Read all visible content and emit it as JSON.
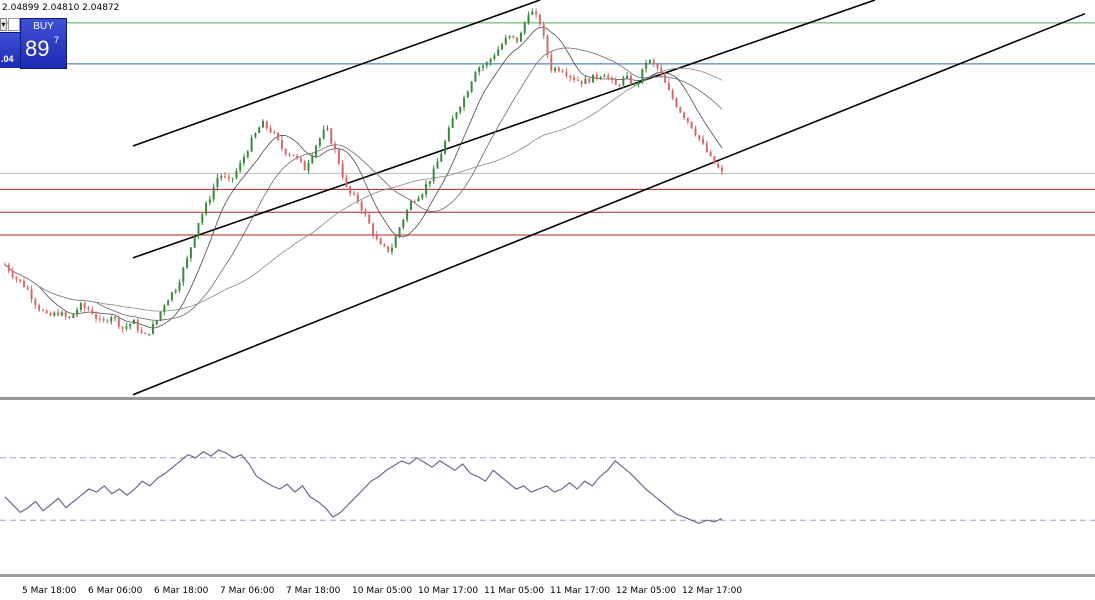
{
  "header": {
    "ohlc_text": "2.04899 2.04810 2.04872"
  },
  "trade_panel": {
    "dropdown_glyph": "▾",
    "buy_label": "BUY",
    "price_small": ".04",
    "price_big": "89",
    "price_sup": "7"
  },
  "colors": {
    "bull": "#3a8a3a",
    "bear": "#d46a6a",
    "ma_fast": "#4a4a4a",
    "ma_mid": "#6a6a6a",
    "ma_slow": "#8a8a8a",
    "channel": "#000000",
    "resistance_green": "#4caf50",
    "resistance_blue": "#2a6fb0",
    "support_red": "#b22222",
    "rsi_line": "#6a6a8e",
    "rsi_levels": "#9a9ab8"
  },
  "chart_data": {
    "type": "candlestick",
    "xlabel": "",
    "ylabel": "",
    "x_tick_labels": [
      "5 Mar 18:00",
      "6 Mar 06:00",
      "6 Mar 18:00",
      "7 Mar 06:00",
      "7 Mar 18:00",
      "10 Mar 05:00",
      "10 Mar 17:00",
      "11 Mar 05:00",
      "11 Mar 17:00",
      "12 Mar 05:00",
      "12 Mar 17:00"
    ],
    "price_path_closes": [
      2.009,
      2.006,
      2.004,
      2.0,
      1.9975,
      1.9985,
      1.997,
      2.0,
      1.999,
      1.996,
      1.998,
      1.995,
      1.9965,
      1.993,
      1.996,
      2.001,
      2.004,
      2.01,
      2.018,
      2.023,
      2.029,
      2.027,
      2.031,
      2.036,
      2.04,
      2.038,
      2.034,
      2.033,
      2.03,
      2.035,
      2.039,
      2.033,
      2.025,
      2.023,
      2.018,
      2.013,
      2.012,
      2.018,
      2.023,
      2.025,
      2.029,
      2.035,
      2.042,
      2.046,
      2.052,
      2.053,
      2.056,
      2.059,
      2.058,
      2.065,
      2.062,
      2.052,
      2.052,
      2.05,
      2.049,
      2.05,
      2.051,
      2.048,
      2.05,
      2.048,
      2.054,
      2.052,
      2.047,
      2.043,
      2.04,
      2.036,
      2.032,
      2.029
    ],
    "levels": {
      "resistance_top": 2.062,
      "resistance_mid": 2.053,
      "current_price": 2.029,
      "support_1": 2.0255,
      "support_2": 2.0205,
      "support_3": 2.0155
    },
    "y_range": [
      1.98,
      2.067
    ],
    "oscillator": {
      "upper_level": 70,
      "lower_level": 30,
      "range": [
        0,
        100
      ],
      "values": [
        45,
        40,
        35,
        38,
        42,
        36,
        40,
        44,
        38,
        42,
        46,
        50,
        48,
        52,
        47,
        50,
        46,
        50,
        55,
        52,
        57,
        60,
        64,
        68,
        72,
        70,
        74,
        71,
        75,
        73,
        70,
        72,
        66,
        58,
        55,
        52,
        50,
        53,
        48,
        52,
        45,
        42,
        38,
        32,
        35,
        40,
        45,
        50,
        55,
        58,
        62,
        65,
        68,
        66,
        70,
        67,
        64,
        68,
        65,
        62,
        66,
        60,
        58,
        55,
        62,
        58,
        54,
        50,
        52,
        48,
        50,
        52,
        48,
        50,
        54,
        50,
        55,
        52,
        58,
        62,
        68,
        64,
        60,
        55,
        50,
        46,
        42,
        38,
        34,
        32,
        30,
        28,
        30,
        29,
        31
      ]
    }
  }
}
